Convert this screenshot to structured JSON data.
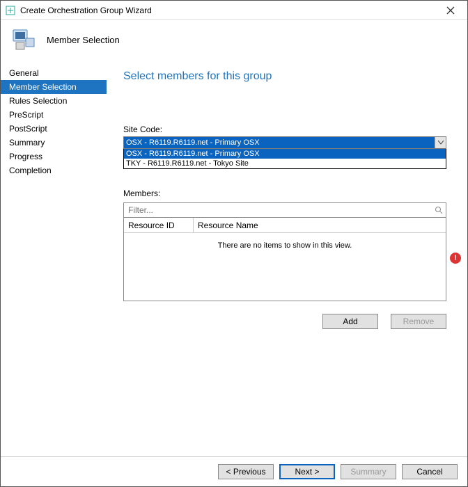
{
  "window": {
    "title": "Create Orchestration Group Wizard"
  },
  "header": {
    "subtitle": "Member Selection"
  },
  "sidebar": {
    "items": [
      {
        "label": "General"
      },
      {
        "label": "Member Selection"
      },
      {
        "label": "Rules Selection"
      },
      {
        "label": "PreScript"
      },
      {
        "label": "PostScript"
      },
      {
        "label": "Summary"
      },
      {
        "label": "Progress"
      },
      {
        "label": "Completion"
      }
    ],
    "selected_index": 1
  },
  "main": {
    "page_title": "Select members for this group",
    "site_code_label": "Site Code:",
    "site_code_selected": "OSX - R6119.R6119.net - Primary OSX",
    "site_code_options": [
      "OSX - R6119.R6119.net - Primary OSX",
      "TKY - R6119.R6119.net - Tokyo Site"
    ],
    "site_code_option_selected_index": 0,
    "members_label": "Members:",
    "filter_placeholder": "Filter...",
    "columns": [
      "Resource ID",
      "Resource Name"
    ],
    "empty_message": "There are no items to show in this view.",
    "add_label": "Add",
    "remove_label": "Remove"
  },
  "footer": {
    "previous": "< Previous",
    "next": "Next >",
    "summary": "Summary",
    "cancel": "Cancel"
  }
}
